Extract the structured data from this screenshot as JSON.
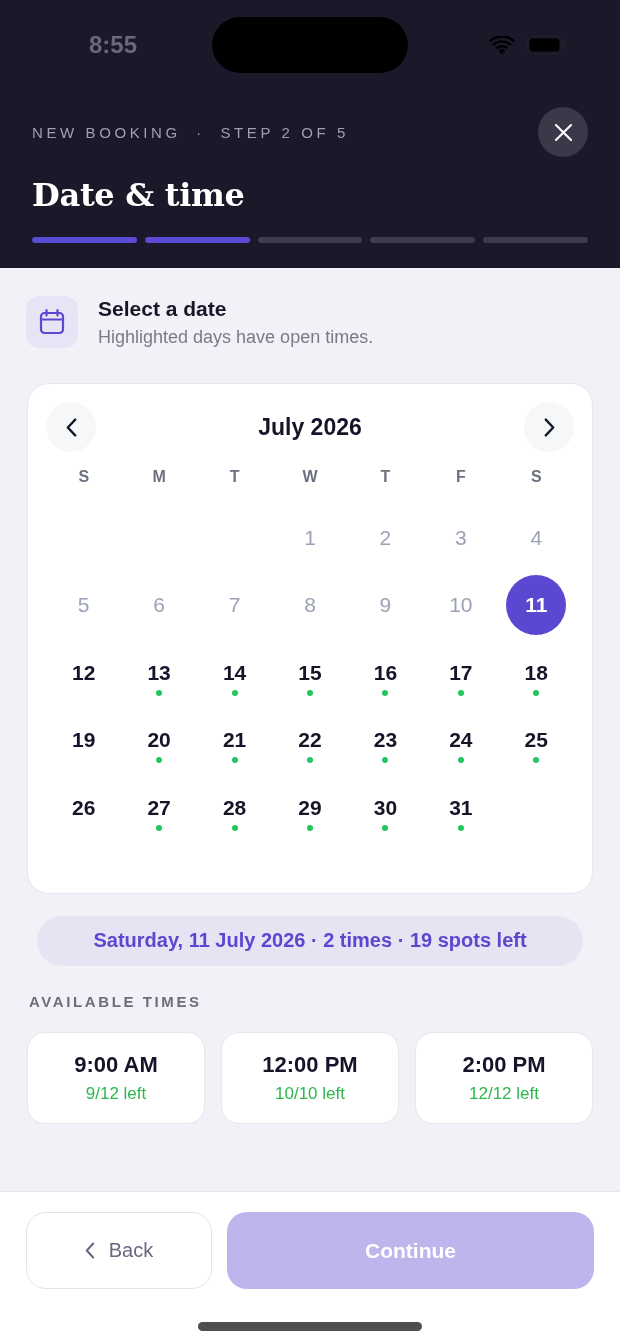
{
  "status_bar": {
    "time": "8:55"
  },
  "header": {
    "eyebrow": "NEW BOOKING  ·  STEP 2 OF 5",
    "title": "Date & time",
    "progress": [
      {
        "completed": true
      },
      {
        "completed": true
      },
      {
        "completed": false
      },
      {
        "completed": false
      },
      {
        "completed": false
      }
    ]
  },
  "date_section": {
    "title": "Select a date",
    "subtitle": "Highlighted days have open times."
  },
  "calendar": {
    "month": "July 2026",
    "weekdays": [
      "S",
      "M",
      "T",
      "W",
      "T",
      "F",
      "S"
    ],
    "weeks": [
      {
        "days": [
          {
            "kind": "blank"
          },
          {
            "kind": "blank"
          },
          {
            "kind": "blank"
          },
          {
            "kind": "day",
            "label": "1",
            "selected": false,
            "disabled": true,
            "available": false
          },
          {
            "kind": "day",
            "label": "2",
            "selected": false,
            "disabled": true,
            "available": false
          },
          {
            "kind": "day",
            "label": "3",
            "selected": false,
            "disabled": true,
            "available": false
          },
          {
            "kind": "day",
            "label": "4",
            "selected": false,
            "disabled": true,
            "available": false
          }
        ]
      },
      {
        "days": [
          {
            "kind": "day",
            "label": "5",
            "selected": false,
            "disabled": true,
            "available": false
          },
          {
            "kind": "day",
            "label": "6",
            "selected": false,
            "disabled": true,
            "available": false
          },
          {
            "kind": "day",
            "label": "7",
            "selected": false,
            "disabled": true,
            "available": false
          },
          {
            "kind": "day",
            "label": "8",
            "selected": false,
            "disabled": true,
            "available": false
          },
          {
            "kind": "day",
            "label": "9",
            "selected": false,
            "disabled": true,
            "available": false
          },
          {
            "kind": "day",
            "label": "10",
            "selected": false,
            "disabled": true,
            "available": false
          },
          {
            "kind": "day",
            "label": "11",
            "selected": true,
            "disabled": false,
            "available": false
          }
        ]
      },
      {
        "days": [
          {
            "kind": "day",
            "label": "12",
            "selected": false,
            "disabled": false,
            "available": false
          },
          {
            "kind": "day",
            "label": "13",
            "selected": false,
            "disabled": false,
            "available": true
          },
          {
            "kind": "day",
            "label": "14",
            "selected": false,
            "disabled": false,
            "available": true
          },
          {
            "kind": "day",
            "label": "15",
            "selected": false,
            "disabled": false,
            "available": true
          },
          {
            "kind": "day",
            "label": "16",
            "selected": false,
            "disabled": false,
            "available": true
          },
          {
            "kind": "day",
            "label": "17",
            "selected": false,
            "disabled": false,
            "available": true
          },
          {
            "kind": "day",
            "label": "18",
            "selected": false,
            "disabled": false,
            "available": true
          }
        ]
      },
      {
        "days": [
          {
            "kind": "day",
            "label": "19",
            "selected": false,
            "disabled": false,
            "available": false
          },
          {
            "kind": "day",
            "label": "20",
            "selected": false,
            "disabled": false,
            "available": true
          },
          {
            "kind": "day",
            "label": "21",
            "selected": false,
            "disabled": false,
            "available": true
          },
          {
            "kind": "day",
            "label": "22",
            "selected": false,
            "disabled": false,
            "available": true
          },
          {
            "kind": "day",
            "label": "23",
            "selected": false,
            "disabled": false,
            "available": true
          },
          {
            "kind": "day",
            "label": "24",
            "selected": false,
            "disabled": false,
            "available": true
          },
          {
            "kind": "day",
            "label": "25",
            "selected": false,
            "disabled": false,
            "available": true
          }
        ]
      },
      {
        "days": [
          {
            "kind": "day",
            "label": "26",
            "selected": false,
            "disabled": false,
            "available": false
          },
          {
            "kind": "day",
            "label": "27",
            "selected": false,
            "disabled": false,
            "available": true
          },
          {
            "kind": "day",
            "label": "28",
            "selected": false,
            "disabled": false,
            "available": true
          },
          {
            "kind": "day",
            "label": "29",
            "selected": false,
            "disabled": false,
            "available": true
          },
          {
            "kind": "day",
            "label": "30",
            "selected": false,
            "disabled": false,
            "available": true
          },
          {
            "kind": "day",
            "label": "31",
            "selected": false,
            "disabled": false,
            "available": true
          },
          {
            "kind": "blank"
          }
        ]
      }
    ]
  },
  "summary": "Saturday, 11 July 2026 · 2 times · 19 spots left",
  "times": {
    "heading": "AVAILABLE TIMES",
    "slots": [
      {
        "time": "9:00 AM",
        "remaining": "9/12 left",
        "selected": false
      },
      {
        "time": "12:00 PM",
        "remaining": "10/10 left",
        "selected": false
      },
      {
        "time": "2:00 PM",
        "remaining": "12/12 left",
        "selected": false
      }
    ]
  },
  "footer": {
    "back": {
      "label": "Back"
    },
    "continue": {
      "label": "Continue",
      "disabled": true
    }
  }
}
